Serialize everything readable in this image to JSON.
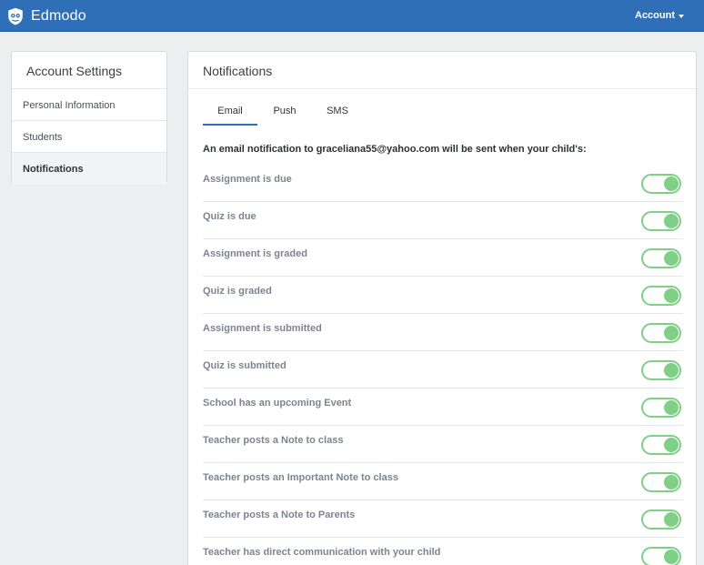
{
  "header": {
    "brand": "Edmodo",
    "account_label": "Account"
  },
  "sidebar": {
    "title": "Account Settings",
    "items": [
      {
        "label": "Personal Information",
        "active": false
      },
      {
        "label": "Students",
        "active": false
      },
      {
        "label": "Notifications",
        "active": true
      }
    ]
  },
  "main": {
    "title": "Notifications",
    "tabs": [
      {
        "label": "Email",
        "active": true
      },
      {
        "label": "Push",
        "active": false
      },
      {
        "label": "SMS",
        "active": false
      }
    ],
    "intro": "An email notification to graceliana55@yahoo.com will be sent when your child's:",
    "settings": [
      {
        "label": "Assignment is due",
        "enabled": true
      },
      {
        "label": "Quiz is due",
        "enabled": true
      },
      {
        "label": "Assignment is graded",
        "enabled": true
      },
      {
        "label": "Quiz is graded",
        "enabled": true
      },
      {
        "label": "Assignment is submitted",
        "enabled": true
      },
      {
        "label": "Quiz is submitted",
        "enabled": true
      },
      {
        "label": "School has an upcoming Event",
        "enabled": true
      },
      {
        "label": "Teacher posts a Note to class",
        "enabled": true
      },
      {
        "label": "Teacher posts an Important Note to class",
        "enabled": true
      },
      {
        "label": "Teacher posts a Note to Parents",
        "enabled": true
      },
      {
        "label": "Teacher has direct communication with your child",
        "enabled": true
      }
    ]
  },
  "colors": {
    "topbar": "#2f6fb7",
    "toggle_on": "#7fcf86",
    "tab_underline": "#2f6fb7"
  },
  "icons": {
    "brand": "edmodo-logo-icon",
    "account": "chevron-down-icon"
  }
}
